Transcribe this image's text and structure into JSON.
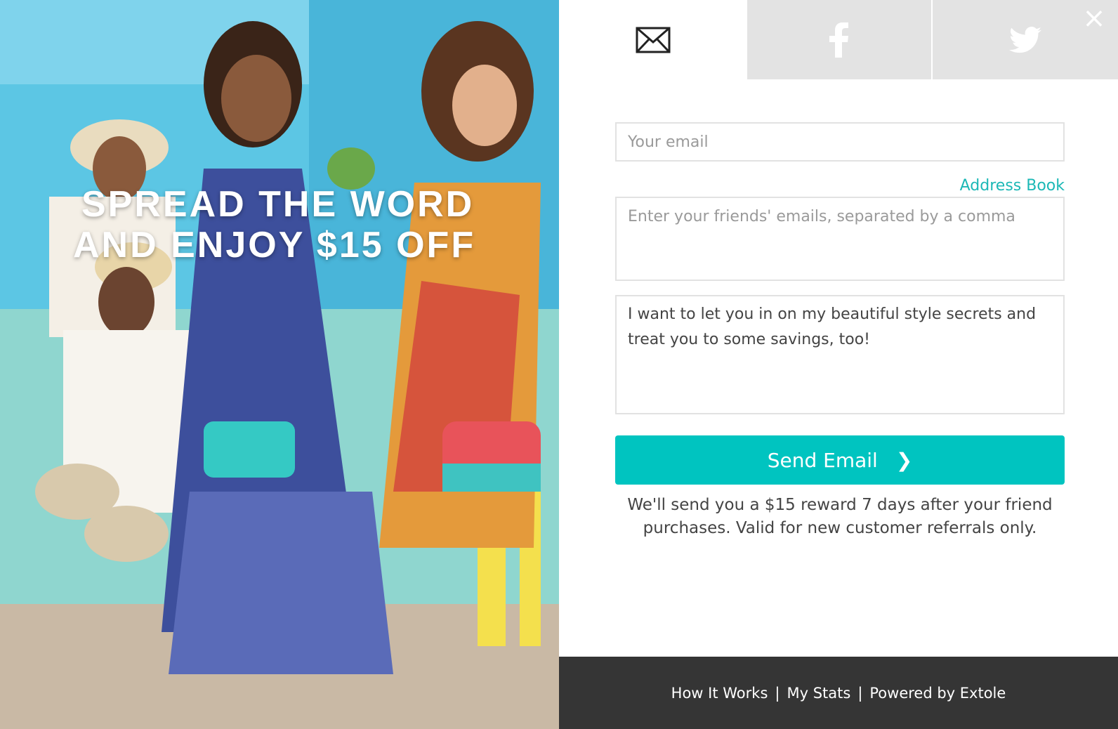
{
  "hero": {
    "headline_line1": "SPREAD THE WORD",
    "headline_line2": "AND ENJOY $15 OFF"
  },
  "tabs": [
    {
      "name": "email",
      "icon": "envelope-icon",
      "active": true
    },
    {
      "name": "facebook",
      "icon": "facebook-icon",
      "active": false
    },
    {
      "name": "twitter",
      "icon": "twitter-icon",
      "active": false
    }
  ],
  "close": {
    "label": "×"
  },
  "form": {
    "email_placeholder": "Your email",
    "address_book_label": "Address Book",
    "friends_placeholder": "Enter your friends' emails, separated by a comma",
    "message_value": "I want to let you in on my beautiful style secrets and treat you to some savings, too!",
    "send_label": "Send Email",
    "send_chevron": "❯",
    "reward_note": "We'll send you a $15 reward 7 days after your friend purchases. Valid for new customer referrals only."
  },
  "footer": {
    "links": [
      "How It Works",
      "My Stats",
      "Powered by Extole"
    ],
    "separator": "|"
  },
  "colors": {
    "accent": "#00c4c0",
    "footer_bg": "#353535",
    "tab_inactive": "#e3e3e3"
  }
}
